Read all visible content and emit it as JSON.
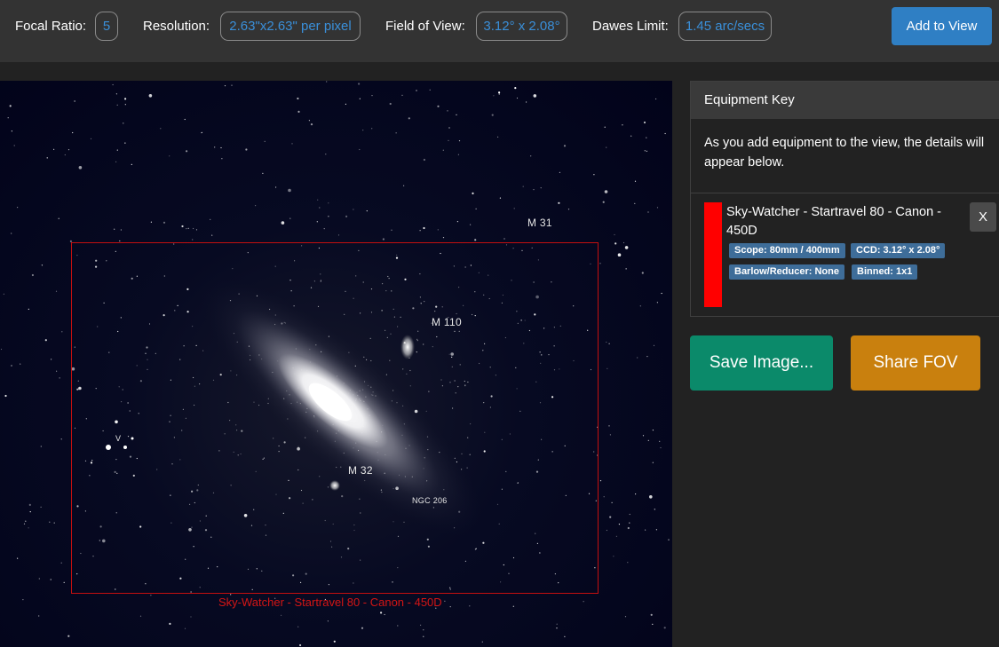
{
  "stats": {
    "focal_ratio": {
      "label": "Focal Ratio:",
      "value": "5"
    },
    "resolution": {
      "label": "Resolution:",
      "value": "2.63\"x2.63\" per pixel"
    },
    "field_of_view": {
      "label": "Field of View:",
      "value": "3.12° x 2.08°"
    },
    "dawes_limit": {
      "label": "Dawes Limit:",
      "value": "1.45 arc/secs"
    }
  },
  "add_button": "Add to View",
  "sky": {
    "labels": {
      "m31": "M 31",
      "m110": "M 110",
      "m32": "M 32",
      "ngc206": "NGC 206",
      "v": "V"
    },
    "fov_caption": "Sky-Watcher - Startravel 80 - Canon - 450D",
    "fov_color": "#c40f0f"
  },
  "equipment_key": {
    "title": "Equipment Key",
    "description": "As you add equipment to the view, the details will appear below.",
    "items": [
      {
        "name": "Sky-Watcher - Startravel 80 - Canon - 450D",
        "color": "#ff0000",
        "remove_label": "X",
        "tags": {
          "scope": "Scope: 80mm / 400mm",
          "ccd": "CCD: 3.12° x 2.08°",
          "barlow": "Barlow/Reducer: None",
          "binned": "Binned: 1x1"
        }
      }
    ]
  },
  "actions": {
    "save": "Save Image...",
    "share": "Share FOV"
  },
  "colors": {
    "accent_blue": "#2f7fc4",
    "save_green": "#0b8a6a",
    "share_orange": "#c9800e",
    "tag_blue": "#3e6d99"
  }
}
